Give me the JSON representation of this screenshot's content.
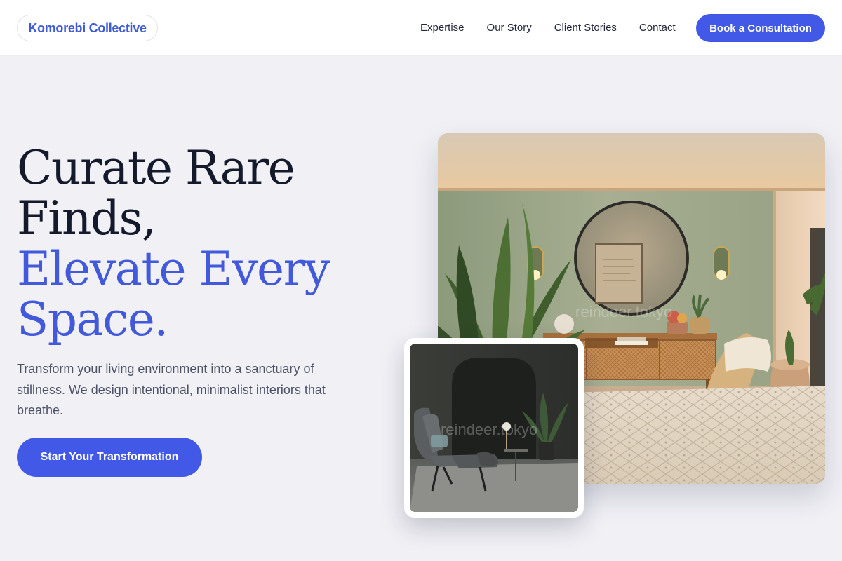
{
  "header": {
    "logo": "Komorebi Collective",
    "nav": [
      {
        "label": "Expertise"
      },
      {
        "label": "Our Story"
      },
      {
        "label": "Client Stories"
      },
      {
        "label": "Contact"
      }
    ],
    "cta": "Book a Consultation"
  },
  "hero": {
    "headline_line1": "Curate Rare",
    "headline_line2": "Finds,",
    "headline_accent_line1": "Elevate Every",
    "headline_accent_line2": "Space.",
    "subtext": "Transform your living environment into a sanctuary of stillness. We design intentional, minimalist interiors that breathe.",
    "cta": "Start Your Transformation"
  },
  "images": {
    "main_watermark": "reindeer.tokyo",
    "inset_watermark": "reindeer.tokyo"
  },
  "colors": {
    "accent": "#4258e6",
    "headline_accent": "#4259db",
    "background": "#f0f0f5"
  }
}
